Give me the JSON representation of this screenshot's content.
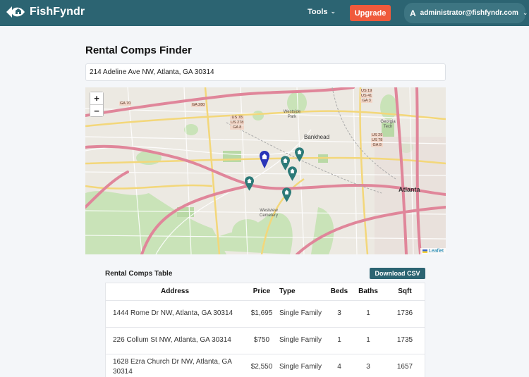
{
  "header": {
    "brand": "FishFyndr",
    "tools_label": "Tools",
    "upgrade_label": "Upgrade",
    "account_initial": "A",
    "account_email": "administrator@fishfyndr.com"
  },
  "page": {
    "title": "Rental Comps Finder",
    "address_value": "214 Adeline Ave NW, Atlanta, GA 30314"
  },
  "map": {
    "zoom_in": "+",
    "zoom_out": "−",
    "attribution": "Leaflet",
    "labels": {
      "bankhead": "Bankhead",
      "atlanta": "Atlanta",
      "westview": "Westview Cemetery",
      "westside": "Westside Park",
      "georgia": "Georgia Tech",
      "ga70": "GA 70",
      "ga280": "GA 280",
      "us78a": "US 78",
      "us278": "US 278",
      "ga8a": "GA 8",
      "us19": "US 19",
      "us41": "US 41",
      "ga3": "GA 3",
      "us29": "US 29",
      "us78b": "US 78",
      "ga8b": "GA 8"
    }
  },
  "table": {
    "heading": "Rental Comps Table",
    "download_label": "Download CSV",
    "columns": [
      "Address",
      "Price",
      "Type",
      "Beds",
      "Baths",
      "Sqft"
    ],
    "rows": [
      {
        "address": "1444 Rome Dr NW, Atlanta, GA 30314",
        "price": "$1,695",
        "type": "Single Family",
        "beds": "3",
        "baths": "1",
        "sqft": "1736"
      },
      {
        "address": "226 Collum St NW, Atlanta, GA 30314",
        "price": "$750",
        "type": "Single Family",
        "beds": "1",
        "baths": "1",
        "sqft": "1735"
      },
      {
        "address": "1628 Ezra Church Dr NW, Atlanta, GA 30314",
        "price": "$2,550",
        "type": "Single Family",
        "beds": "4",
        "baths": "3",
        "sqft": "1657"
      }
    ]
  },
  "colors": {
    "header_bg": "#2c6472",
    "upgrade_bg": "#ef5a3c",
    "primary_marker": "#2a35b8",
    "comp_marker": "#2c7a78"
  }
}
